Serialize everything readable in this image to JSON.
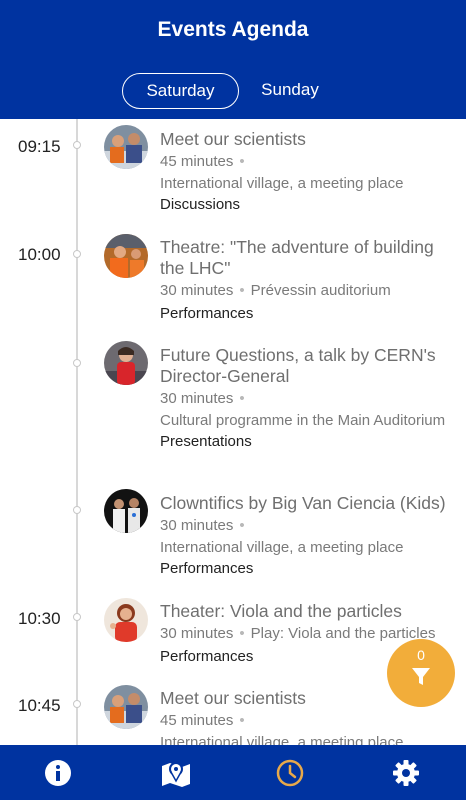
{
  "header": {
    "title": "Events Agenda"
  },
  "tabs": [
    {
      "label": "Saturday",
      "selected": true
    },
    {
      "label": "Sunday",
      "selected": false
    }
  ],
  "times": [
    "09:15",
    "10:00",
    "10:30",
    "10:45"
  ],
  "events": [
    {
      "title": "Meet our scientists",
      "duration": "45 minutes",
      "venue": "",
      "location": "International village, a meeting place",
      "category": "Discussions"
    },
    {
      "title": "Theatre: \"The adventure of building the LHC\"",
      "duration": "30 minutes",
      "venue": "Prévessin auditorium",
      "location": "",
      "category": "Performances"
    },
    {
      "title": "Future Questions, a talk by CERN's Director-General",
      "duration": "30 minutes",
      "venue": "",
      "location": "Cultural programme in the Main Auditorium",
      "category": "Presentations"
    },
    {
      "title": "Clowntifics by Big Van Ciencia (Kids)",
      "duration": "30 minutes",
      "venue": "",
      "location": "International village, a meeting place",
      "category": "Performances"
    },
    {
      "title": "Theater: Viola and the particles",
      "duration": "30 minutes",
      "venue": "Play: Viola and the particles",
      "location": "",
      "category": "Performances"
    },
    {
      "title": "Meet our scientists",
      "duration": "45 minutes",
      "venue": "",
      "location": "International village, a meeting place",
      "category": ""
    }
  ],
  "meta_separator": "•",
  "filter": {
    "count": "0"
  },
  "nav": [
    "info-icon",
    "map-icon",
    "clock-icon",
    "gear-icon"
  ],
  "colors": {
    "primary": "#0033a0",
    "accent": "#f2ad3a",
    "active_nav": "#e8a94a"
  }
}
